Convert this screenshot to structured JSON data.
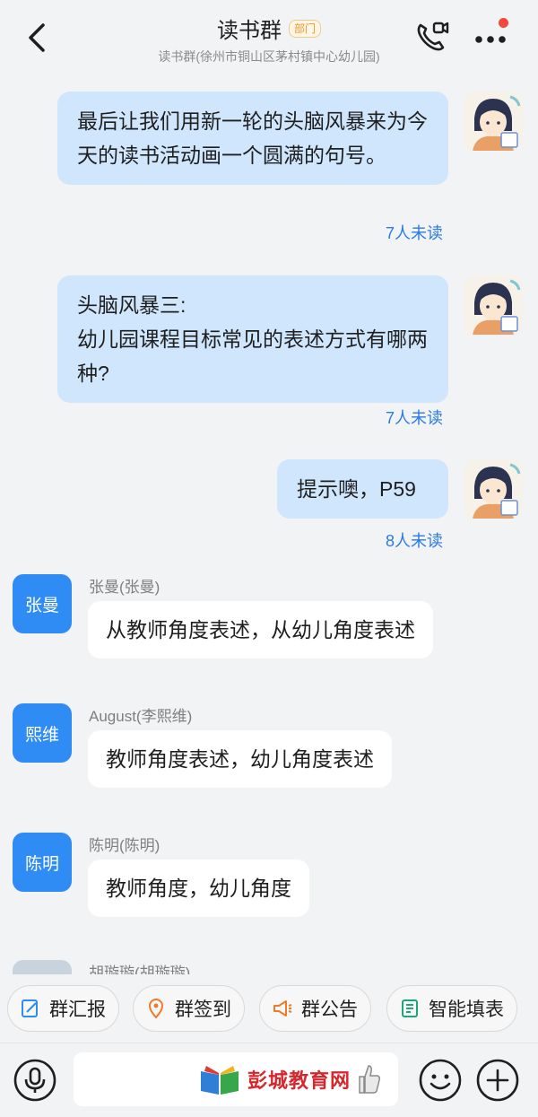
{
  "header": {
    "title": "读书群",
    "badge": "部门",
    "subtitle": "读书群(徐州市铜山区茅村镇中心幼儿园)"
  },
  "messages_out": [
    {
      "text": "最后让我们用新一轮的头脑风暴来为今天的读书活动画一个圆满的句号。",
      "unread": "7人未读"
    },
    {
      "text": "头脑风暴三:\n幼儿园课程目标常见的表述方式有哪两种?",
      "unread": "7人未读"
    },
    {
      "text": "提示噢，P59",
      "unread": "8人未读"
    }
  ],
  "messages_in": [
    {
      "avatar": "张曼",
      "sender": "张曼(张曼)",
      "text": "从教师角度表述，从幼儿角度表述"
    },
    {
      "avatar": "熙维",
      "sender": "August(李熙维)",
      "text": "教师角度表述，幼儿角度表述"
    },
    {
      "avatar": "陈明",
      "sender": "陈明(陈明)",
      "text": "教师角度，幼儿角度"
    },
    {
      "avatar": "",
      "sender": "胡璇璇(胡璇璇)",
      "text": ""
    }
  ],
  "quick_actions": [
    "群汇报",
    "群签到",
    "群公告",
    "智能填表"
  ],
  "input": {
    "placeholder": ""
  },
  "watermark": "彭城教育网",
  "colors": {
    "accent": "#2f8cf5",
    "bubble_out": "#cfe6fd",
    "unread": "#2a7be4",
    "badge": "#e69a2e",
    "red_dot": "#f5483b"
  }
}
